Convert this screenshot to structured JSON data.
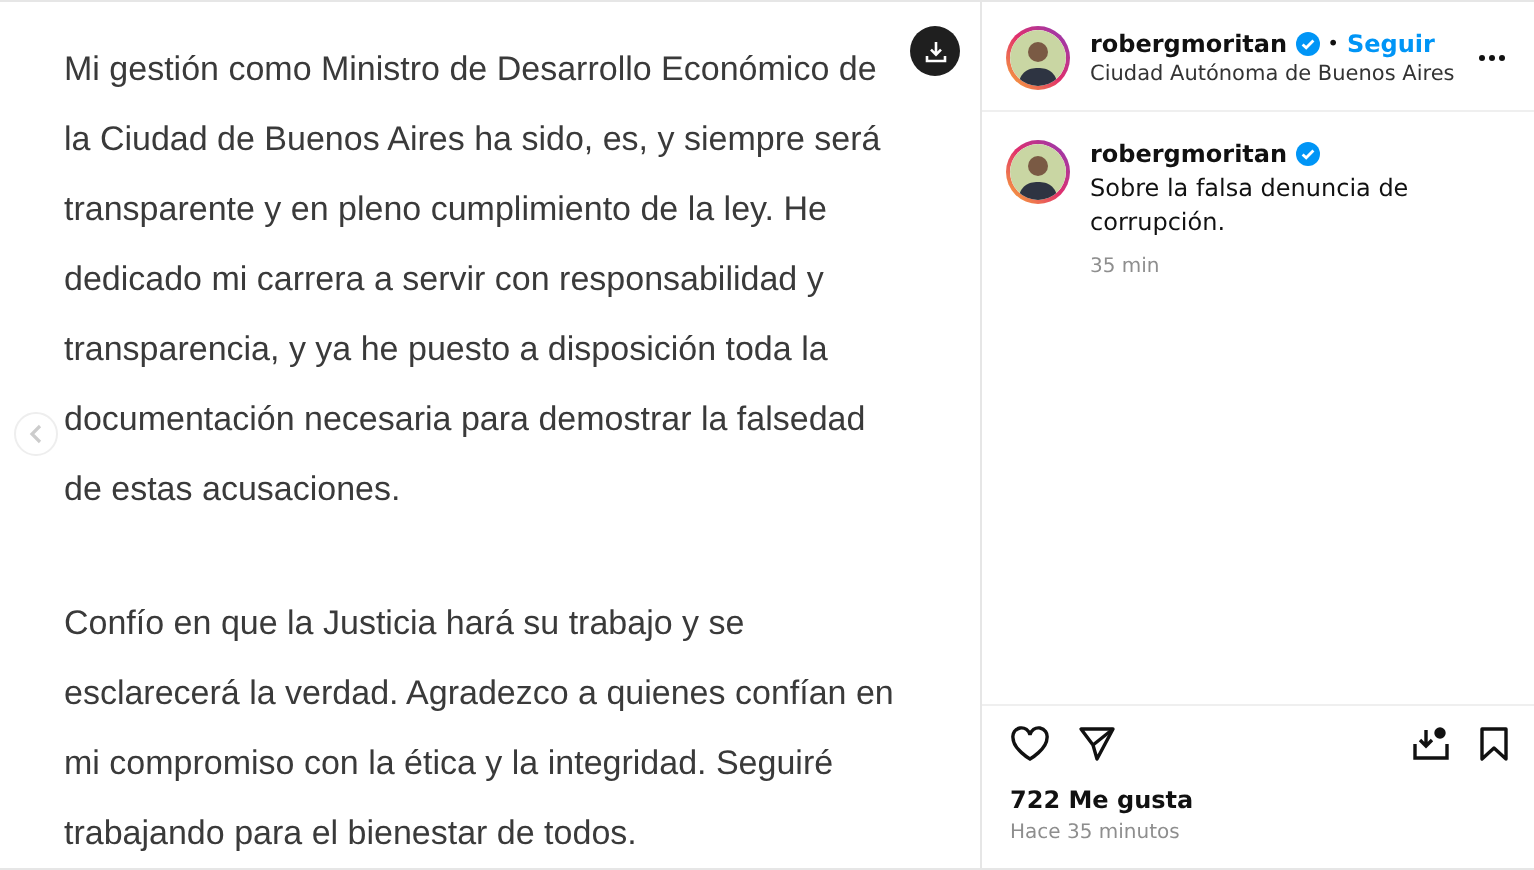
{
  "post_image": {
    "paragraphs": [
      "Mi gestión como Ministro de Desarrollo Económico de la Ciudad de Buenos Aires ha sido, es, y siempre será transparente y en pleno cumplimiento de la ley. He dedicado mi carrera a servir con responsabilidad y transparencia, y ya he puesto a disposición toda la documentación necesaria para demostrar la falsedad de estas acusaciones.",
      "Confío en que la Justicia hará su trabajo y se esclarecerá la verdad. Agradezco a quienes confían en mi compromiso con la ética y la integridad. Seguiré trabajando para el bienestar de todos."
    ]
  },
  "header": {
    "username": "robergmoritan",
    "verified": true,
    "separator": "•",
    "follow": "Seguir",
    "location": "Ciudad Autónoma de Buenos Aires"
  },
  "caption": {
    "username": "robergmoritan",
    "verified": true,
    "text": "Sobre la falsa denuncia de corrupción.",
    "time": "35 min"
  },
  "actions": {
    "liked": false,
    "saved": false
  },
  "likes": "722 Me gusta",
  "date": "Hace 35 minutos"
}
